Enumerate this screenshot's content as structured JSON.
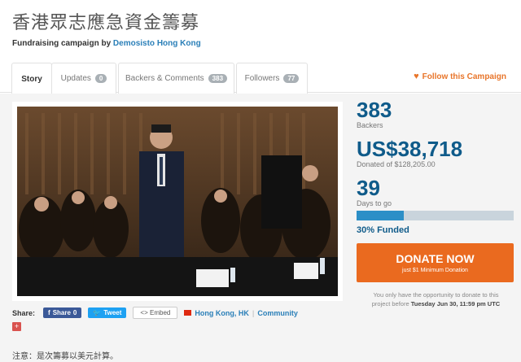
{
  "header": {
    "title": "香港眾志應急資金籌募",
    "subtitle_prefix": "Fundraising campaign by",
    "organizer": "Demosisto Hong Kong"
  },
  "tabs": [
    {
      "label": "Story",
      "count": null
    },
    {
      "label": "Updates",
      "count": "0"
    },
    {
      "label": "Backers & Comments",
      "count": "383"
    },
    {
      "label": "Followers",
      "count": "77"
    }
  ],
  "follow_label": "Follow this Campaign",
  "stats": {
    "backers_count": "383",
    "backers_label": "Backers",
    "raised": "US$38,718",
    "raised_label": "Donated of $128,205.00",
    "days": "39",
    "days_label": "Days to go",
    "funded_label": "30% Funded",
    "funded_fraction": 0.3
  },
  "donate": {
    "label": "DONATE NOW",
    "sub": "just $1 Minimum Donation"
  },
  "deadline": {
    "line1": "You only have the opportunity to donate to this",
    "line2_prefix": "project before",
    "date": "Tuesday Jun 30, 11:59 pm UTC"
  },
  "share": {
    "label": "Share:",
    "facebook": "Share",
    "facebook_count": "0",
    "twitter": "Tweet",
    "embed": "Embed",
    "location": "Hong Kong, HK",
    "category": "Community"
  },
  "note": "注意：是次籌募以美元計算。",
  "colors": {
    "brand_blue": "#0f5b8a",
    "accent_orange": "#ea6a1f",
    "link_blue": "#2a7fb8"
  }
}
